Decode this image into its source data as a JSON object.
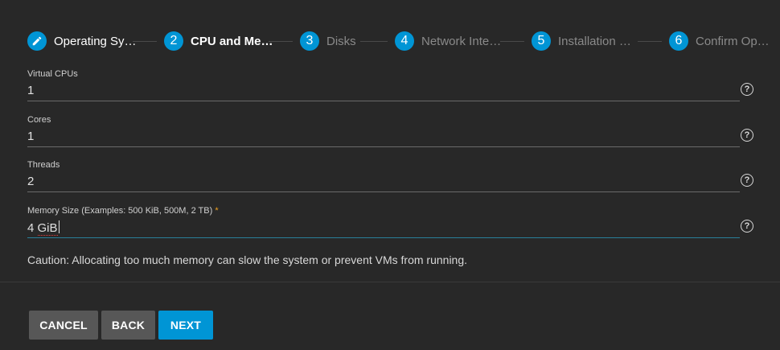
{
  "stepper": {
    "steps": [
      {
        "number": "1",
        "label": "Operating Sy…",
        "state": "done",
        "icon": "pencil-icon"
      },
      {
        "number": "2",
        "label": "CPU and Me…",
        "state": "active"
      },
      {
        "number": "3",
        "label": "Disks",
        "state": "todo"
      },
      {
        "number": "4",
        "label": "Network Inte…",
        "state": "todo"
      },
      {
        "number": "5",
        "label": "Installation …",
        "state": "todo"
      },
      {
        "number": "6",
        "label": "Confirm Op…",
        "state": "todo"
      }
    ]
  },
  "form": {
    "vcpus": {
      "label": "Virtual CPUs",
      "value": "1"
    },
    "cores": {
      "label": "Cores",
      "value": "1"
    },
    "threads": {
      "label": "Threads",
      "value": "2"
    },
    "memory": {
      "label": "Memory Size (Examples: 500 KiB, 500M, 2 TB)",
      "required_mark": "*",
      "value_number": "4",
      "value_unit": "GiB"
    },
    "help_glyph": "?"
  },
  "caution": "Caution: Allocating too much memory can slow the system or prevent VMs from running.",
  "buttons": {
    "cancel": "CANCEL",
    "back": "BACK",
    "next": "NEXT"
  },
  "colors": {
    "accent": "#0095d5",
    "background": "#282828",
    "required": "#f0a020"
  }
}
